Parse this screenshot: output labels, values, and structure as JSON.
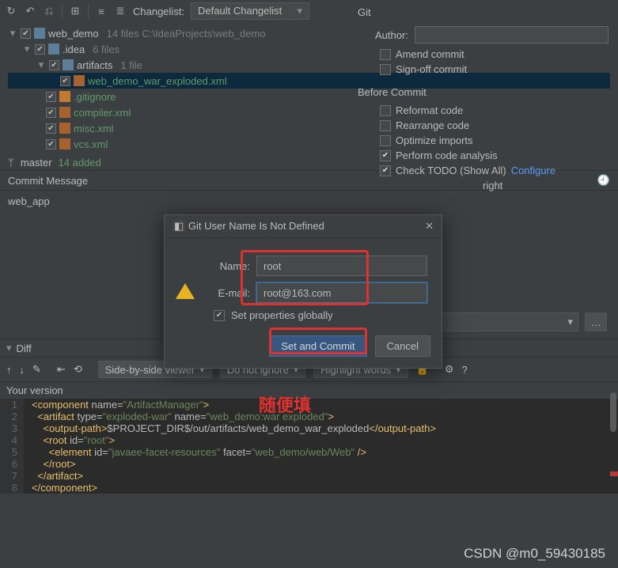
{
  "toolbar": {
    "changelist_label": "Changelist:",
    "changelist_value": "Default Changelist"
  },
  "git_panel": {
    "title": "Git",
    "author_label": "Author:",
    "amend": "Amend commit",
    "signoff": "Sign-off commit",
    "before_commit": "Before Commit",
    "reformat": "Reformat code",
    "rearrange": "Rearrange code",
    "optimize": "Optimize imports",
    "perform": "Perform code analysis",
    "todo": "Check TODO (Show All)",
    "configure": "Configure",
    "copyright_tail": "right"
  },
  "tree": {
    "root": {
      "name": "web_demo",
      "meta": "14 files  C:\\IdeaProjects\\web_demo"
    },
    "idea": {
      "name": ".idea",
      "meta": "6 files"
    },
    "artifacts": {
      "name": "artifacts",
      "meta": "1 file"
    },
    "exploded": "web_demo_war_exploded.xml",
    "gitignore": ".gitignore",
    "compiler": "compiler.xml",
    "misc": "misc.xml",
    "vcs": "vcs.xml"
  },
  "branch": {
    "icon": "ᛘ",
    "name": "master",
    "added": "14 added"
  },
  "commit_msg": {
    "header": "Commit Message",
    "text": "web_app"
  },
  "diff": {
    "title": "Diff",
    "viewer": "Side-by-side viewer",
    "ignore": "Do not ignore",
    "highlight": "Highlight words",
    "your_version": "Your version"
  },
  "dialog": {
    "title": "Git User Name Is Not Defined",
    "name_label": "Name:",
    "name_value": "root",
    "email_label": "E-mail:",
    "email_value": "root@163.com",
    "globally": "Set properties globally",
    "set_commit": "Set and Commit",
    "cancel": "Cancel"
  },
  "annotation": "随便填",
  "watermark": "CSDN @m0_59430185",
  "code_lines": [
    {
      "n": "1",
      "html": "<span class='tag'>&lt;component</span> <span class='attr'>name</span>=<span class='val'>\"ArtifactManager\"</span><span class='tag'>&gt;</span>"
    },
    {
      "n": "2",
      "html": "  <span class='tag'>&lt;artifact</span> <span class='attr'>type</span>=<span class='val'>\"exploded-war\"</span> <span class='attr'>name</span>=<span class='val'>\"web_demo:war exploded\"</span><span class='tag'>&gt;</span>"
    },
    {
      "n": "3",
      "html": "    <span class='tag'>&lt;output-path&gt;</span><span class='txt'>$PROJECT_DIR$/out/artifacts/web_demo_war_exploded</span><span class='tag'>&lt;/output-path&gt;</span>"
    },
    {
      "n": "4",
      "html": "    <span class='tag'>&lt;root</span> <span class='attr'>id</span>=<span class='val'>\"root\"</span><span class='tag'>&gt;</span>"
    },
    {
      "n": "5",
      "html": "      <span class='tag'>&lt;element</span> <span class='attr'>id</span>=<span class='val'>\"javaee-facet-resources\"</span> <span class='attr'>facet</span>=<span class='val'>\"web_demo/web/Web\"</span> <span class='tag'>/&gt;</span>"
    },
    {
      "n": "6",
      "html": "    <span class='tag'>&lt;/root&gt;</span>"
    },
    {
      "n": "7",
      "html": "  <span class='tag'>&lt;/artifact&gt;</span>"
    },
    {
      "n": "8",
      "html": "<span class='tag'>&lt;/component&gt;</span>"
    }
  ]
}
